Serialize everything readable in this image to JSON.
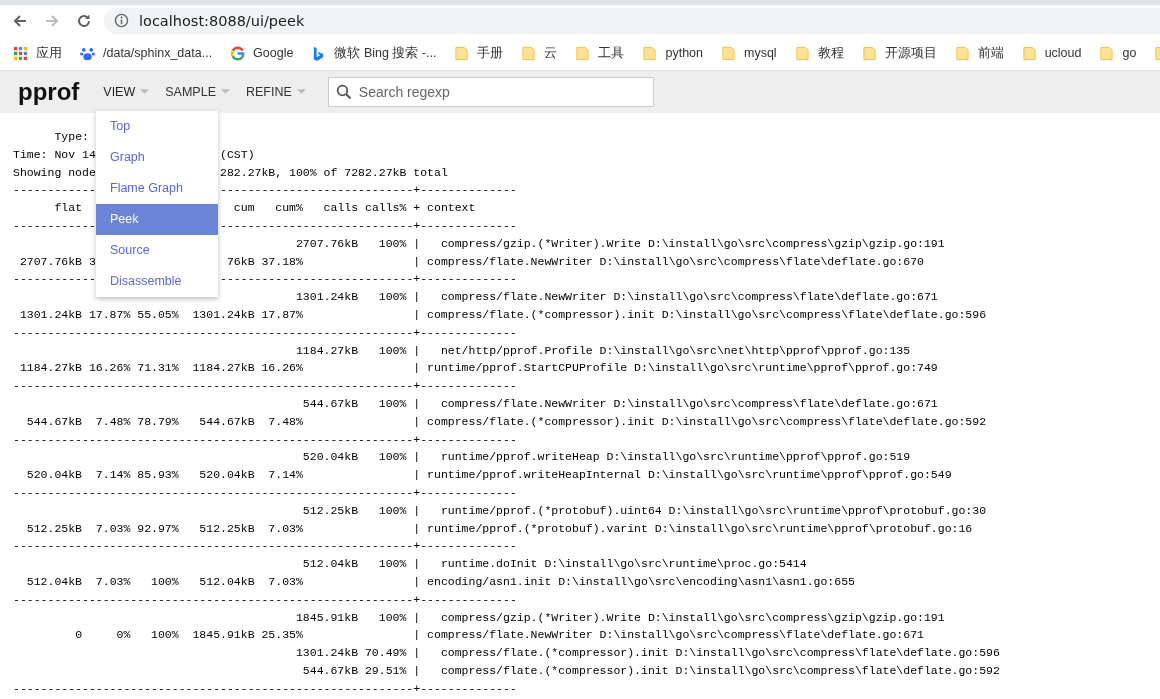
{
  "browser": {
    "nav": {
      "forward_disabled": true
    },
    "address": "localhost:8088/ui/peek",
    "bookmarks": [
      {
        "kind": "apps",
        "label": "应用"
      },
      {
        "kind": "paw",
        "label": "/data/sphinx_data..."
      },
      {
        "kind": "google",
        "label": "Google"
      },
      {
        "kind": "bing",
        "label": "微软 Bing 搜索 -..."
      },
      {
        "kind": "folder",
        "label": "手册"
      },
      {
        "kind": "folder",
        "label": "云"
      },
      {
        "kind": "folder",
        "label": "工具"
      },
      {
        "kind": "folder",
        "label": "python"
      },
      {
        "kind": "folder",
        "label": "mysql"
      },
      {
        "kind": "folder",
        "label": "教程"
      },
      {
        "kind": "folder",
        "label": "开源项目"
      },
      {
        "kind": "folder",
        "label": "前端"
      },
      {
        "kind": "folder",
        "label": "ucloud"
      },
      {
        "kind": "folder",
        "label": "go"
      },
      {
        "kind": "folder"
      }
    ]
  },
  "app": {
    "title": "pprof",
    "menus": [
      {
        "label": "VIEW",
        "open": true,
        "items": [
          {
            "label": "Top",
            "selected": false
          },
          {
            "label": "Graph",
            "selected": false
          },
          {
            "label": "Flame Graph",
            "selected": false
          },
          {
            "label": "Peek",
            "selected": true
          },
          {
            "label": "Source",
            "selected": false
          },
          {
            "label": "Disassemble",
            "selected": false
          }
        ]
      },
      {
        "label": "SAMPLE",
        "open": false
      },
      {
        "label": "REFINE",
        "open": false
      }
    ],
    "search": {
      "placeholder": "Search regexp"
    }
  },
  "report": {
    "lines": [
      {
        "kind": "split",
        "left": "      Type:"
      },
      {
        "kind": "split",
        "left": "Time: Nov 14",
        "right": "(CST)"
      },
      {
        "kind": "split",
        "left": "Showing node",
        "right": "282.27kB, 100% of 7282.27kB total"
      },
      {
        "kind": "split",
        "left": "------------",
        "right": "----------------------------+--------------"
      },
      {
        "kind": "split",
        "left": "      flat",
        "right": "  cum   cum%   calls calls% + context"
      },
      {
        "kind": "split",
        "left": "------------",
        "right": "----------------------------+--------------"
      },
      {
        "kind": "text",
        "text": "                                         2707.76kB   100% |   compress/gzip.(*Writer).Write D:\\install\\go\\src\\compress\\gzip\\gzip.go:191"
      },
      {
        "kind": "split",
        "left": " 2707.76kB 3",
        "right": " 76kB 37.18%                | compress/flate.NewWriter D:\\install\\go\\src\\compress\\flate\\deflate.go:670"
      },
      {
        "kind": "split",
        "left": "------------",
        "right": "----------------------------+--------------"
      },
      {
        "kind": "text",
        "text": "                                         1301.24kB   100% |   compress/flate.NewWriter D:\\install\\go\\src\\compress\\flate\\deflate.go:671"
      },
      {
        "kind": "text",
        "text": " 1301.24kB 17.87% 55.05%  1301.24kB 17.87%                | compress/flate.(*compressor).init D:\\install\\go\\src\\compress\\flate\\deflate.go:596"
      },
      {
        "kind": "text",
        "text": "----------------------------------------------------------+--------------"
      },
      {
        "kind": "text",
        "text": "                                         1184.27kB   100% |   net/http/pprof.Profile D:\\install\\go\\src\\net\\http\\pprof\\pprof.go:135"
      },
      {
        "kind": "text",
        "text": " 1184.27kB 16.26% 71.31%  1184.27kB 16.26%                | runtime/pprof.StartCPUProfile D:\\install\\go\\src\\runtime\\pprof\\pprof.go:749"
      },
      {
        "kind": "text",
        "text": "----------------------------------------------------------+--------------"
      },
      {
        "kind": "text",
        "text": "                                          544.67kB   100% |   compress/flate.NewWriter D:\\install\\go\\src\\compress\\flate\\deflate.go:671"
      },
      {
        "kind": "text",
        "text": "  544.67kB  7.48% 78.79%   544.67kB  7.48%                | compress/flate.(*compressor).init D:\\install\\go\\src\\compress\\flate\\deflate.go:592"
      },
      {
        "kind": "text",
        "text": "----------------------------------------------------------+--------------"
      },
      {
        "kind": "text",
        "text": "                                          520.04kB   100% |   runtime/pprof.writeHeap D:\\install\\go\\src\\runtime\\pprof\\pprof.go:519"
      },
      {
        "kind": "text",
        "text": "  520.04kB  7.14% 85.93%   520.04kB  7.14%                | runtime/pprof.writeHeapInternal D:\\install\\go\\src\\runtime\\pprof\\pprof.go:549"
      },
      {
        "kind": "text",
        "text": "----------------------------------------------------------+--------------"
      },
      {
        "kind": "text",
        "text": "                                          512.25kB   100% |   runtime/pprof.(*protobuf).uint64 D:\\install\\go\\src\\runtime\\pprof\\protobuf.go:30"
      },
      {
        "kind": "text",
        "text": "  512.25kB  7.03% 92.97%   512.25kB  7.03%                | runtime/pprof.(*protobuf).varint D:\\install\\go\\src\\runtime\\pprof\\protobuf.go:16"
      },
      {
        "kind": "text",
        "text": "----------------------------------------------------------+--------------"
      },
      {
        "kind": "text",
        "text": "                                          512.04kB   100% |   runtime.doInit D:\\install\\go\\src\\runtime\\proc.go:5414"
      },
      {
        "kind": "text",
        "text": "  512.04kB  7.03%   100%   512.04kB  7.03%                | encoding/asn1.init D:\\install\\go\\src\\encoding\\asn1\\asn1.go:655"
      },
      {
        "kind": "text",
        "text": "----------------------------------------------------------+--------------"
      },
      {
        "kind": "text",
        "text": "                                         1845.91kB   100% |   compress/gzip.(*Writer).Write D:\\install\\go\\src\\compress\\gzip\\gzip.go:191"
      },
      {
        "kind": "text",
        "text": "         0     0%   100%  1845.91kB 25.35%                | compress/flate.NewWriter D:\\install\\go\\src\\compress\\flate\\deflate.go:671"
      },
      {
        "kind": "text",
        "text": "                                         1301.24kB 70.49% |   compress/flate.(*compressor).init D:\\install\\go\\src\\compress\\flate\\deflate.go:596"
      },
      {
        "kind": "text",
        "text": "                                          544.67kB 29.51% |   compress/flate.(*compressor).init D:\\install\\go\\src\\compress\\flate\\deflate.go:592"
      },
      {
        "kind": "text",
        "text": "----------------------------------------------------------+--------------"
      }
    ]
  }
}
